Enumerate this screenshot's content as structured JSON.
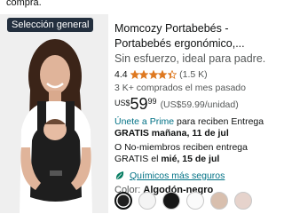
{
  "top_text": "compra.",
  "product": {
    "badge": "Selección general",
    "title": "Momcozy Portabebés -",
    "title_line2": "Portabebés ergonómico,...",
    "subtitle": "Sin esfuerzo, ideal para padre...",
    "rating": "4.4",
    "rating_value": 4.4,
    "rating_count": "(1.5 K)",
    "bought": "3 K+ comprados el mes pasado",
    "price": {
      "currency": "US$",
      "whole": "59",
      "fraction": "99",
      "unit_price": "(US$59.99/unidad)"
    },
    "prime_link": "Únete a Prime",
    "prime_text": " para reciben Entrega",
    "prime_delivery": "GRATIS mañana, 11 de jul",
    "nonmember_text": "O No-miembros reciben entrega",
    "nonmember_delivery_prefix": "GRATIS el ",
    "nonmember_delivery_date": "mié, 15 de jul",
    "climate": "Químicos más seguros",
    "color_label": "Color: ",
    "color_value": "Algodón-negro",
    "swatches": [
      {
        "name": "Algodón-negro",
        "color": "#1f1f1f",
        "selected": true
      },
      {
        "name": "Gris claro",
        "color": "#f4f4f4",
        "selected": false
      },
      {
        "name": "Negro",
        "color": "#161616",
        "selected": false
      },
      {
        "name": "Blanco",
        "color": "#fafafa",
        "selected": false
      },
      {
        "name": "Beige",
        "color": "#d8bfae",
        "selected": false
      },
      {
        "name": "Rosa",
        "color": "#e6d3cc",
        "selected": false
      }
    ]
  },
  "colors": {
    "star": "#de7921",
    "link": "#007185",
    "badge_bg": "#232f3e",
    "leaf": "#067d62"
  }
}
